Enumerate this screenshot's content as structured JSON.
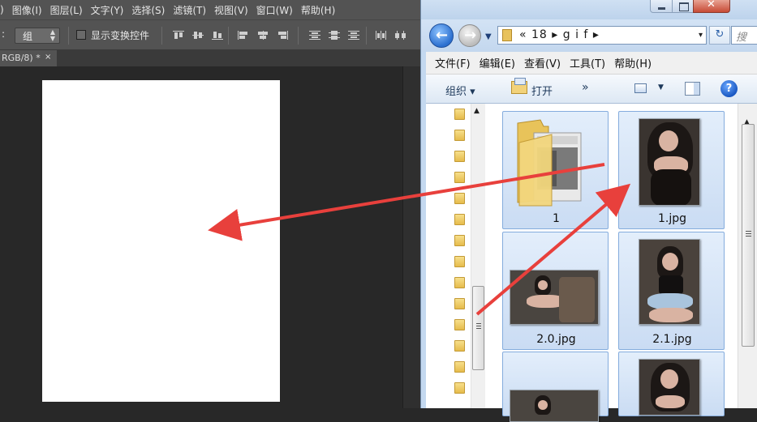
{
  "photoshop": {
    "menu": [
      "图像(I)",
      "图层(L)",
      "文字(Y)",
      "选择(S)",
      "滤镜(T)",
      "视图(V)",
      "窗口(W)",
      "帮助(H)"
    ],
    "menu_partial": ")",
    "options": {
      "colon": ":",
      "auto_select_value": "组",
      "show_transform_label": "显示变换控件",
      "show_transform_checked": false
    },
    "tab": {
      "title": "RGB/8) *",
      "close": "×"
    }
  },
  "explorer": {
    "caption": {
      "close_glyph": "✕"
    },
    "address": {
      "path": "« 18 ▸ g i f ▸",
      "dropdown": "▾",
      "search_placeholder": "搜"
    },
    "menu": [
      "文件(F)",
      "编辑(E)",
      "查看(V)",
      "工具(T)",
      "帮助(H)"
    ],
    "toolbar": {
      "organize": "组织 ▾",
      "open": "打开",
      "more": "»",
      "view_dropdown": "▼",
      "help": "?"
    },
    "items": [
      {
        "name": "1",
        "kind": "folder"
      },
      {
        "name": "1.jpg",
        "kind": "image"
      },
      {
        "name": "2.0.jpg",
        "kind": "image"
      },
      {
        "name": "2.1.jpg",
        "kind": "image"
      },
      {
        "name": "",
        "kind": "image"
      },
      {
        "name": "",
        "kind": "image"
      }
    ]
  },
  "colors": {
    "annotation_arrow": "#e8403c",
    "ps_panel": "#535353",
    "ps_workspace": "#282828",
    "explorer_selection": "#cadcf3"
  }
}
